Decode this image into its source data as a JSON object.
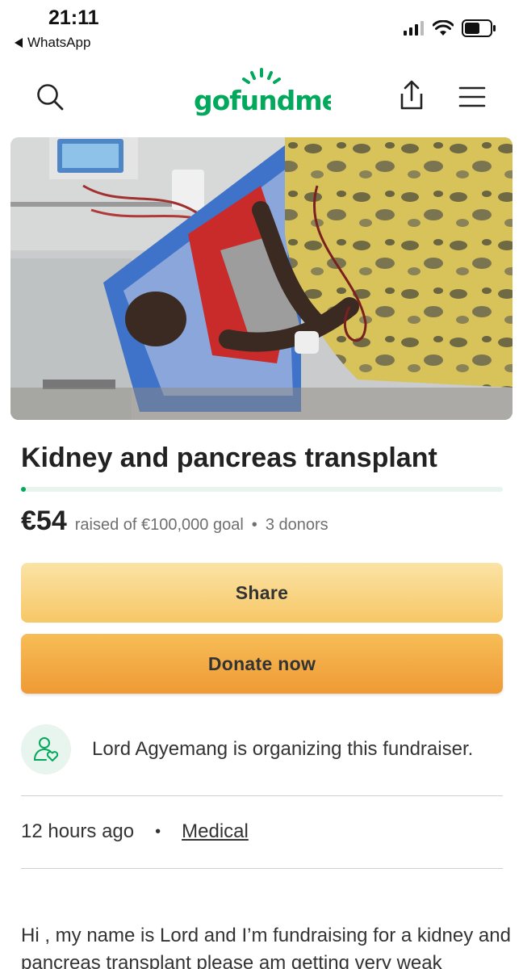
{
  "status_bar": {
    "time": "21:11",
    "back_app": "WhatsApp"
  },
  "nav": {
    "logo_text": "gofundme",
    "icons": [
      "search-icon",
      "share-upload-icon",
      "hamburger-menu-icon"
    ]
  },
  "photo": {
    "description_icon": "fundraiser-photo"
  },
  "campaign": {
    "title": "Kidney and pancreas transplant",
    "amount": "€54",
    "raised_text": "raised of €100,000 goal",
    "donors_text": "3 donors",
    "progress_fraction": 0.00054
  },
  "buttons": {
    "share_label": "Share",
    "donate_label": "Donate now"
  },
  "organizer": {
    "text": "Lord Agyemang is organizing this fundraiser."
  },
  "meta": {
    "time_ago": "12 hours ago",
    "category": "Medical"
  },
  "story": {
    "text": "Hi , my name is Lord and I’m fundraising for a kidney and pancreas transplant please am getting very weak"
  },
  "colors": {
    "brand_green": "#02a95c",
    "share_button": "#f8d27f",
    "donate_button": "#f2a842"
  }
}
